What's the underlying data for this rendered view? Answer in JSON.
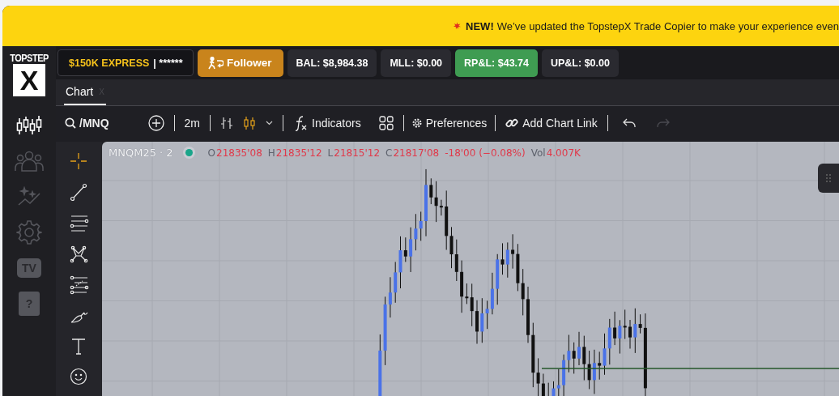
{
  "banner": {
    "badge": "NEW!",
    "message": "We’ve updated the TopstepX Trade Copier to make your experience even"
  },
  "logo": {
    "top": "TOPSTEP",
    "mark": "X"
  },
  "sidebar": {
    "items": [
      {
        "kind": "icon",
        "selected": true
      },
      {
        "kind": "icon",
        "selected": false
      },
      {
        "kind": "icon",
        "selected": false
      },
      {
        "kind": "icon",
        "selected": false
      },
      {
        "kind": "badge",
        "label": "TV",
        "selected": false
      },
      {
        "kind": "badge",
        "label": "?",
        "selected": false
      }
    ]
  },
  "header": {
    "account": {
      "name": "$150K EXPRESS",
      "masked": "| ******"
    },
    "follower": "Follower",
    "stats": [
      {
        "label": "BAL: $8,984.38",
        "kind": "neutral"
      },
      {
        "label": "MLL: $0.00",
        "kind": "neutral"
      },
      {
        "label": "RP&L: $43.74",
        "kind": "positive"
      },
      {
        "label": "UP&L: $0.00",
        "kind": "neutral"
      }
    ]
  },
  "tabs": [
    {
      "label": "Chart",
      "close": "X",
      "selected": true
    }
  ],
  "toolbar": {
    "symbol": "/MNQ",
    "interval": "2m",
    "chart_types": [
      {
        "selected": false
      },
      {
        "selected": true
      }
    ],
    "indicators": "Indicators",
    "preferences": "Preferences",
    "chart_link": "Add Chart Link",
    "undo": {
      "disabled": false
    },
    "redo": {
      "disabled": true
    }
  },
  "drawing_tools": [
    {
      "selected": true
    },
    {
      "selected": false
    },
    {
      "selected": false
    },
    {
      "selected": false
    },
    {
      "selected": false
    },
    {
      "selected": false
    },
    {
      "selected": false
    },
    {
      "selected": false
    }
  ],
  "legend": {
    "symbol": "MNQM25 · 2",
    "items": [
      {
        "label": "O",
        "value": "21835'08"
      },
      {
        "label": "H",
        "value": "21835'12"
      },
      {
        "label": "L",
        "value": "21815'12"
      },
      {
        "label": "C",
        "value": "21817'08"
      },
      {
        "value": "-18'00 (−0.08%)"
      },
      {
        "label": "Vol",
        "value": "4.007K"
      }
    ]
  }
}
